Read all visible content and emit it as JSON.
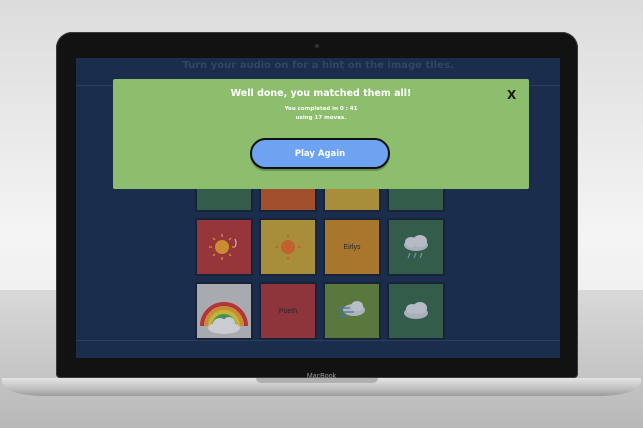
{
  "screen": {
    "header_text": "Turn your audio on for a hint on the image tiles."
  },
  "modal": {
    "title": "Well done, you matched them all!",
    "time_line": "You completed in 0 : 41",
    "moves_line": "using 17 moves.",
    "close_label": "X",
    "play_again_label": "Play Again"
  },
  "tiles": {
    "row2_col3_label": "Eirlys",
    "row3_col2_label": "Poeth"
  },
  "laptop": {
    "brand": "MacBook"
  },
  "colors": {
    "screen_bg": "#1d3050",
    "modal_bg": "#8cbe6e",
    "button_bg": "#6ea3f2",
    "tile_red": "#a83a3a",
    "tile_orange": "#c8892a",
    "tile_amber": "#c9a53a",
    "tile_green": "#3a6b4d"
  }
}
